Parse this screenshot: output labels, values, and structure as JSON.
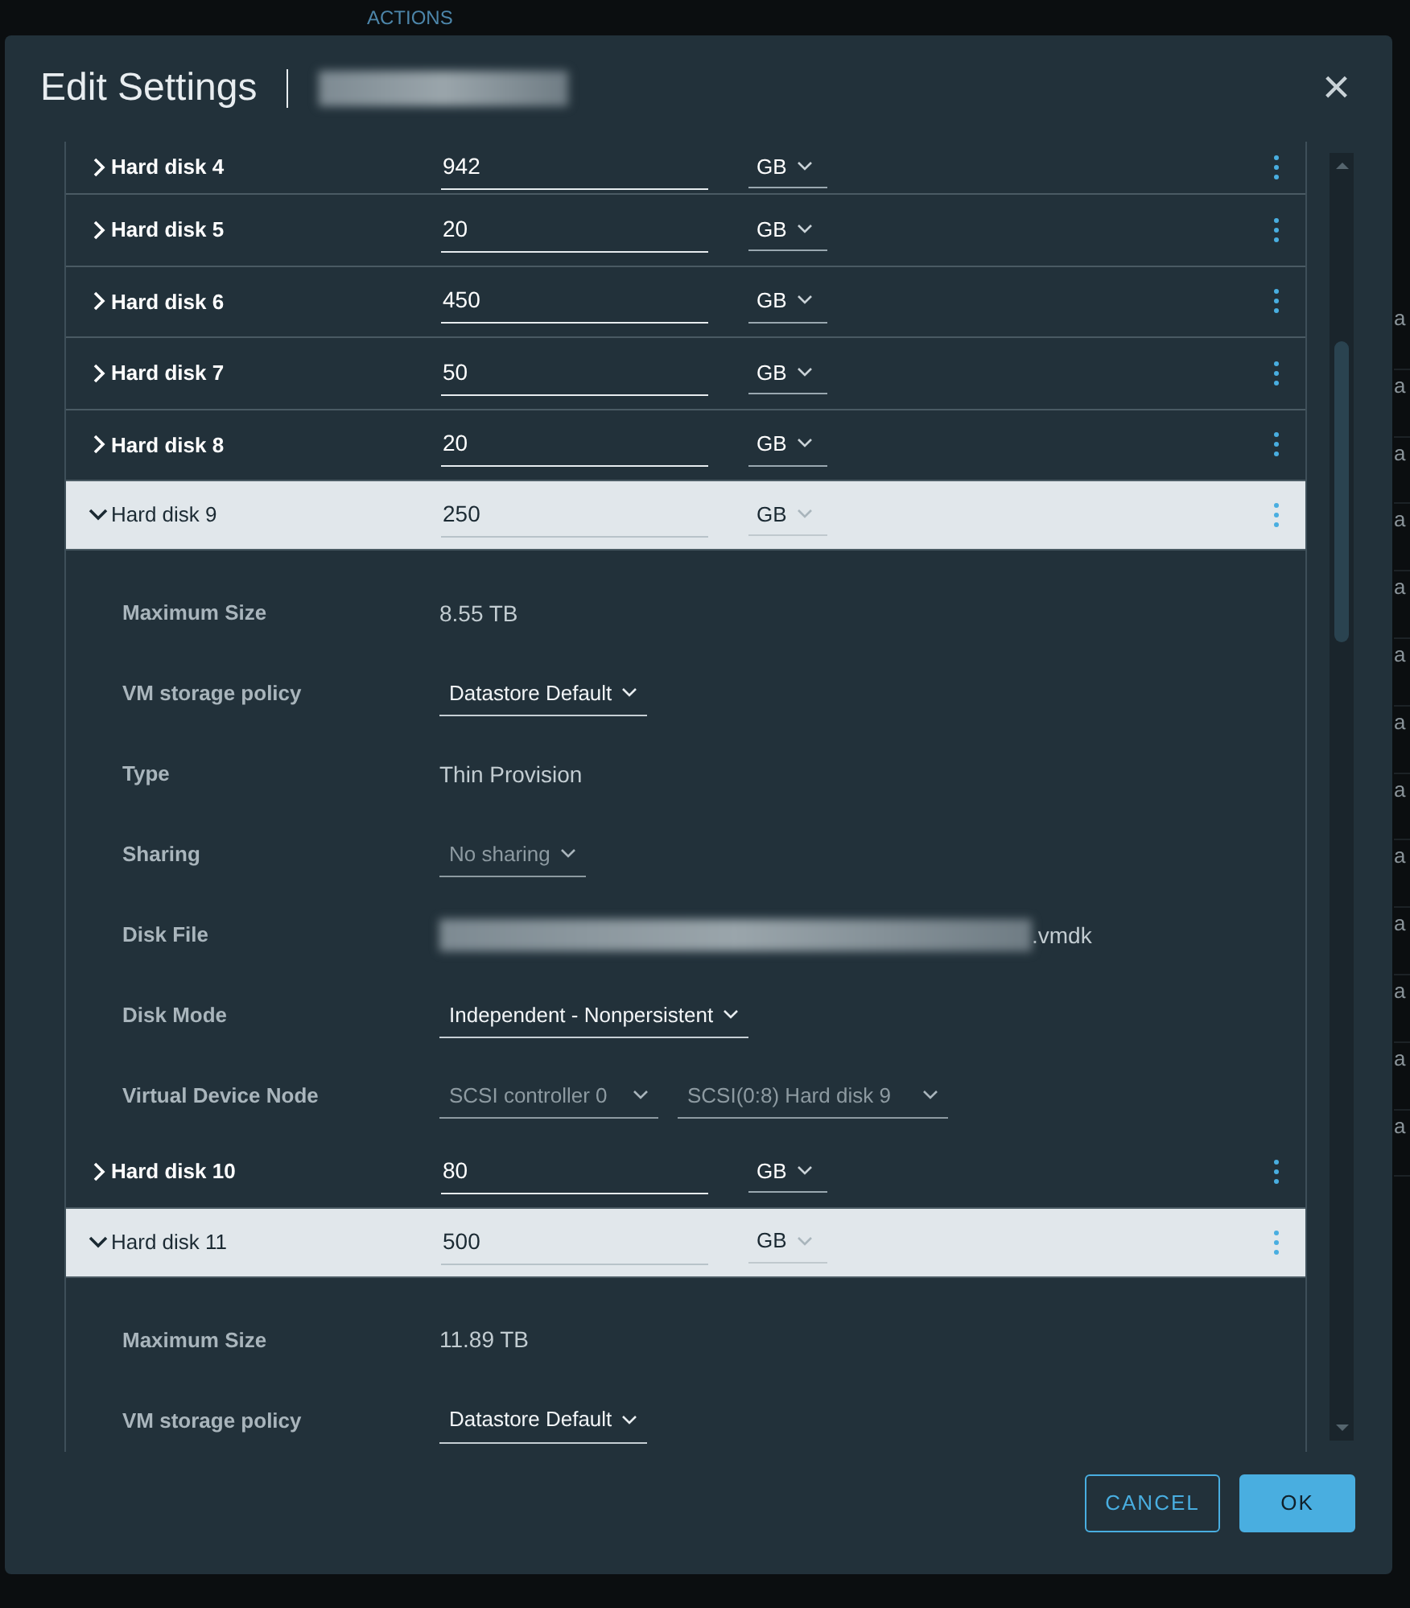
{
  "backdrop": {
    "toolbar_label": "ACTIONS",
    "right_cells": [
      "a",
      "a",
      "a",
      "a",
      "a",
      "a",
      "a",
      "a",
      "a",
      "a",
      "a",
      "a",
      "a"
    ]
  },
  "dialog": {
    "title": "Edit Settings",
    "close_icon": "×"
  },
  "disks": [
    {
      "name": "Hard disk 4",
      "size": "942",
      "unit": "GB",
      "expanded": false
    },
    {
      "name": "Hard disk 5",
      "size": "20",
      "unit": "GB",
      "expanded": false
    },
    {
      "name": "Hard disk 6",
      "size": "450",
      "unit": "GB",
      "expanded": false
    },
    {
      "name": "Hard disk 7",
      "size": "50",
      "unit": "GB",
      "expanded": false
    },
    {
      "name": "Hard disk 8",
      "size": "20",
      "unit": "GB",
      "expanded": false
    },
    {
      "name": "Hard disk 9",
      "size": "250",
      "unit": "GB",
      "expanded": true,
      "details": [
        {
          "kind": "text",
          "label": "Maximum Size",
          "value": "8.55 TB"
        },
        {
          "kind": "select",
          "label": "VM storage policy",
          "value": "Datastore Default",
          "disabled": false
        },
        {
          "kind": "text",
          "label": "Type",
          "value": "Thin Provision"
        },
        {
          "kind": "select",
          "label": "Sharing",
          "value": "No sharing",
          "disabled": true
        },
        {
          "kind": "file",
          "label": "Disk File",
          "value": ".vmdk"
        },
        {
          "kind": "select",
          "label": "Disk Mode",
          "value": "Independent - Nonpersistent",
          "disabled": false
        },
        {
          "kind": "select-pair",
          "label": "Virtual Device Node",
          "values": [
            "SCSI controller 0",
            "SCSI(0:8) Hard disk 9"
          ],
          "disabled": true
        }
      ]
    },
    {
      "name": "Hard disk 10",
      "size": "80",
      "unit": "GB",
      "expanded": false
    },
    {
      "name": "Hard disk 11",
      "size": "500",
      "unit": "GB",
      "expanded": true,
      "details": [
        {
          "kind": "text",
          "label": "Maximum Size",
          "value": "11.89 TB"
        },
        {
          "kind": "select",
          "label": "VM storage policy",
          "value": "Datastore Default",
          "disabled": false
        }
      ]
    }
  ],
  "buttons": [
    {
      "label": "CANCEL",
      "kind": "secondary"
    },
    {
      "label": "OK",
      "kind": "primary"
    }
  ]
}
